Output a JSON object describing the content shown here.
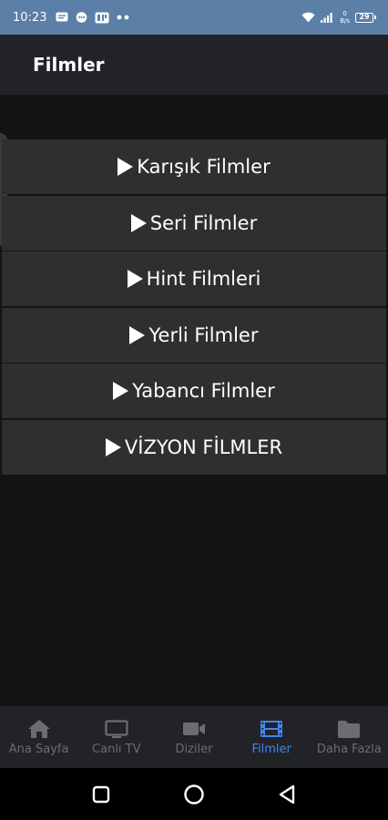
{
  "status_bar": {
    "time": "10:23",
    "net_speed_value": "0",
    "net_speed_unit": "B/s",
    "battery": "29"
  },
  "app_bar": {
    "title": "Filmler"
  },
  "menu": {
    "items": [
      {
        "label": "Karışık Filmler"
      },
      {
        "label": "Seri Filmler"
      },
      {
        "label": "Hint Filmleri"
      },
      {
        "label": "Yerli Filmler"
      },
      {
        "label": "Yabancı Filmler"
      },
      {
        "label": "VİZYON FİLMLER"
      }
    ]
  },
  "bottom_nav": {
    "items": [
      {
        "label": "Ana Sayfa",
        "icon": "home-icon",
        "active": false
      },
      {
        "label": "Canlı TV",
        "icon": "tv-icon",
        "active": false
      },
      {
        "label": "Diziler",
        "icon": "video-camera-icon",
        "active": false
      },
      {
        "label": "Filmler",
        "icon": "film-icon",
        "active": true
      },
      {
        "label": "Daha Fazla",
        "icon": "folder-icon",
        "active": false
      }
    ]
  },
  "colors": {
    "status_bar": "#5b7fa6",
    "app_bar": "#222326",
    "background": "#141414",
    "menu_item": "#2f2f2f",
    "nav_active": "#4285f4",
    "nav_inactive": "#6d6d70"
  }
}
